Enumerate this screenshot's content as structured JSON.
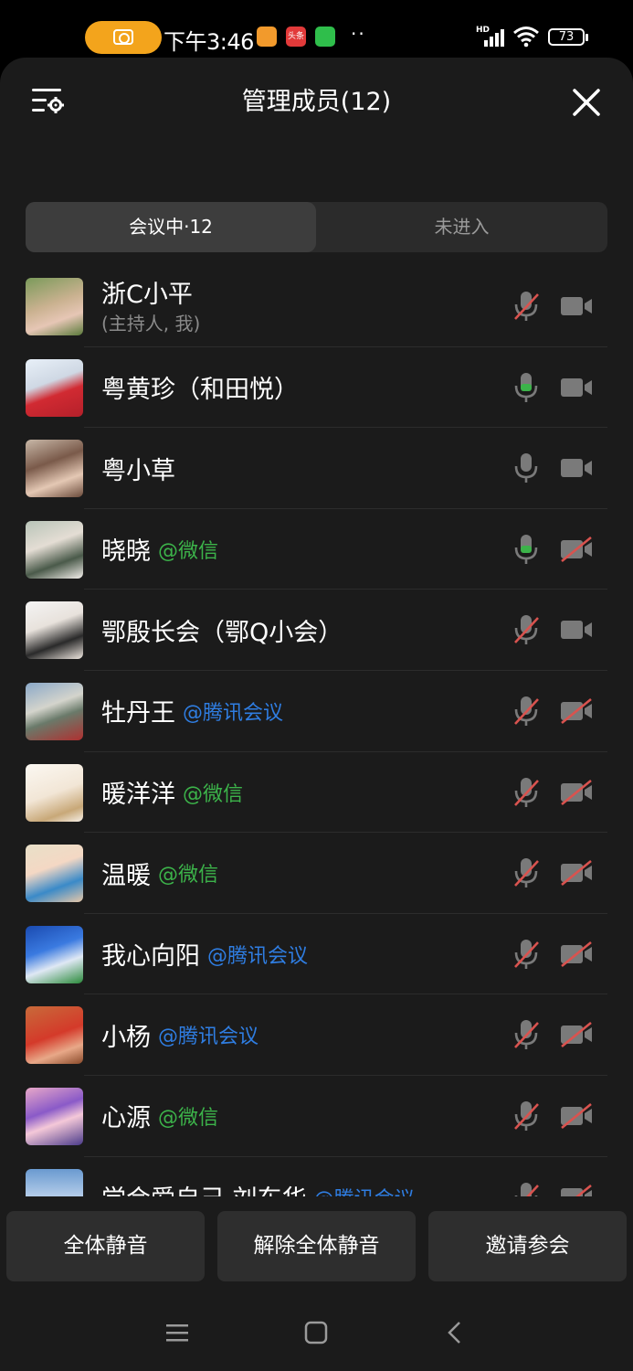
{
  "status_bar": {
    "time": "下午3:46",
    "app_badge": "头条",
    "battery": "73",
    "network": "HD"
  },
  "header": {
    "title": "管理成员(12)"
  },
  "tabs": {
    "in_meeting": "会议中·12",
    "not_joined": "未进入"
  },
  "members": [
    {
      "name": "浙C小平",
      "tag": "",
      "tag_type": "",
      "role": "(主持人, 我)",
      "mic": "muted",
      "camera": "off_gray"
    },
    {
      "name": "粤黄珍（和田悦）",
      "tag": "",
      "tag_type": "",
      "role": "",
      "mic": "on_green",
      "camera": "off_gray"
    },
    {
      "name": "粤小草",
      "tag": "",
      "tag_type": "",
      "role": "",
      "mic": "on_gray",
      "camera": "off_gray"
    },
    {
      "name": "晓晓",
      "tag": "@微信",
      "tag_type": "wechat",
      "role": "",
      "mic": "on_green",
      "camera": "disabled"
    },
    {
      "name": "鄂殷长会（鄂Q小会）",
      "tag": "",
      "tag_type": "",
      "role": "",
      "mic": "muted",
      "camera": "off_gray"
    },
    {
      "name": "牡丹王",
      "tag": "@腾讯会议",
      "tag_type": "tencent",
      "role": "",
      "mic": "muted",
      "camera": "disabled"
    },
    {
      "name": "暖洋洋",
      "tag": "@微信",
      "tag_type": "wechat",
      "role": "",
      "mic": "muted",
      "camera": "disabled"
    },
    {
      "name": "温暖",
      "tag": "@微信",
      "tag_type": "wechat",
      "role": "",
      "mic": "muted",
      "camera": "disabled"
    },
    {
      "name": "我心向阳",
      "tag": "@腾讯会议",
      "tag_type": "tencent",
      "role": "",
      "mic": "muted",
      "camera": "disabled"
    },
    {
      "name": "小杨",
      "tag": "@腾讯会议",
      "tag_type": "tencent",
      "role": "",
      "mic": "muted",
      "camera": "disabled"
    },
    {
      "name": "心源",
      "tag": "@微信",
      "tag_type": "wechat",
      "role": "",
      "mic": "muted",
      "camera": "disabled"
    },
    {
      "name": "学会爱自己 刘东华",
      "tag": "@腾讯会议",
      "tag_type": "tencent",
      "role": "",
      "mic": "muted",
      "camera": "disabled"
    }
  ],
  "actions": {
    "mute_all": "全体静音",
    "unmute_all": "解除全体静音",
    "invite": "邀请参会"
  },
  "colors": {
    "green": "#3cb34a",
    "blue": "#2f7de1",
    "red": "#d9534f",
    "background": "#1b1b1b"
  }
}
